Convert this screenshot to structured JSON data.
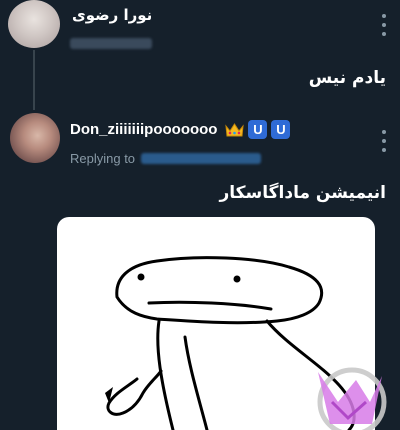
{
  "tweet1": {
    "author_name": "نورا رضوی",
    "text": "یادم نیس"
  },
  "tweet2": {
    "author_name": "Don_ziiiiiiipooooooo",
    "badges": [
      "👑",
      "U",
      "U"
    ],
    "replying_label": "Replying to",
    "text": "انیمیشن ماداگاسکار"
  },
  "colors": {
    "background": "#15202b",
    "secondary_text": "#8899a6",
    "badge_blue": "#2f6bd6"
  }
}
